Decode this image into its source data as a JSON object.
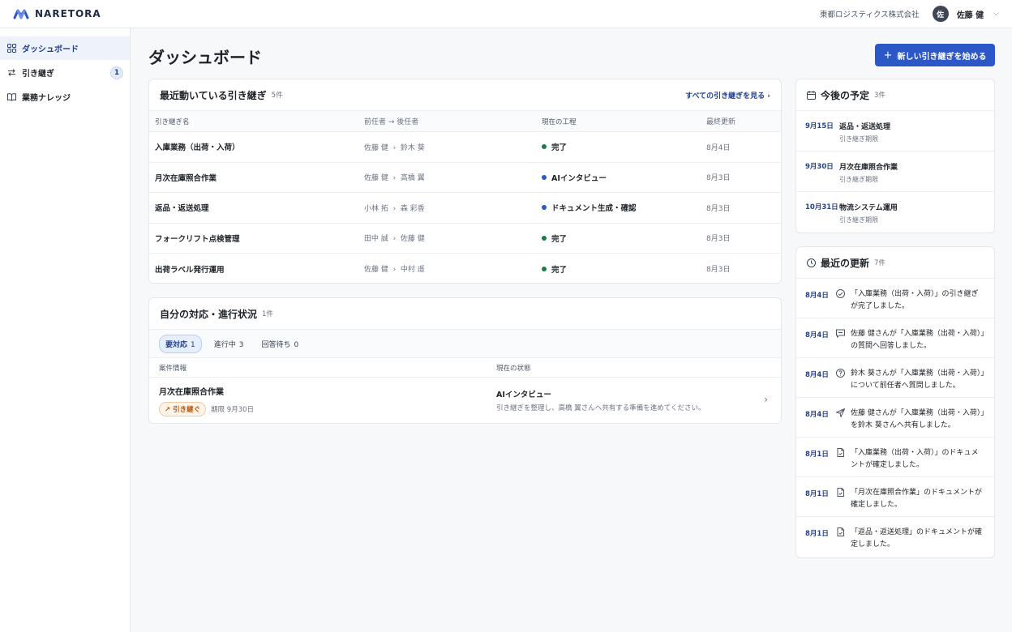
{
  "brand": {
    "name": "NARETORA"
  },
  "user": {
    "company": "東都ロジスティクス株式会社",
    "avatar_initial": "佐",
    "name": "佐藤 健"
  },
  "sidebar": {
    "items": [
      {
        "label": "ダッシュボード",
        "icon": "grid-icon",
        "active": true
      },
      {
        "label": "引き継ぎ",
        "icon": "swap-icon",
        "badge": "1"
      },
      {
        "label": "業務ナレッジ",
        "icon": "book-icon"
      }
    ]
  },
  "page": {
    "title": "ダッシュボード",
    "new_button": "新しい引き継ぎを始める"
  },
  "handovers": {
    "title": "最近動いている引き継ぎ",
    "count": "5件",
    "see_all": "すべての引き継ぎを見る",
    "columns": [
      "引き継ぎ名",
      "前任者 → 後任者",
      "現在の工程",
      "最終更新"
    ],
    "rows": [
      {
        "name": "入庫業務（出荷・入荷）",
        "from": "佐藤 健",
        "to": "鈴木 葵",
        "stage": "完了",
        "stage_color": "#1f7a4a",
        "updated": "8月4日"
      },
      {
        "name": "月次在庫照合作業",
        "from": "佐藤 健",
        "to": "高橋 翼",
        "stage": "AIインタビュー",
        "stage_color": "#2b57c7",
        "updated": "8月3日"
      },
      {
        "name": "返品・返送処理",
        "from": "小林 拓",
        "to": "森 彩香",
        "stage": "ドキュメント生成・確認",
        "stage_color": "#2b57c7",
        "updated": "8月3日"
      },
      {
        "name": "フォークリフト点検管理",
        "from": "田中 誠",
        "to": "佐藤 健",
        "stage": "完了",
        "stage_color": "#1f7a4a",
        "updated": "8月3日"
      },
      {
        "name": "出荷ラベル発行運用",
        "from": "佐藤 健",
        "to": "中村 遥",
        "stage": "完了",
        "stage_color": "#1f7a4a",
        "updated": "8月3日"
      }
    ]
  },
  "tasks": {
    "title": "自分の対応・進行状況",
    "count": "1件",
    "tabs": [
      {
        "label": "要対応",
        "count": "1",
        "active": true
      },
      {
        "label": "進行中",
        "count": "3"
      },
      {
        "label": "回答待ち",
        "count": "0"
      }
    ],
    "columns": [
      "案件情報",
      "現在の状態"
    ],
    "rows": [
      {
        "name": "月次在庫照合作業",
        "tag": "引き継ぐ",
        "due": "期限 9月30日",
        "state": "AIインタビュー",
        "state_desc": "引き継ぎを整理し、高橋 翼さんへ共有する準備を進めてください。"
      }
    ]
  },
  "schedule": {
    "title": "今後の予定",
    "count": "3件",
    "items": [
      {
        "date": "9月15日",
        "title": "返品・返送処理",
        "sub": "引き継ぎ期限"
      },
      {
        "date": "9月30日",
        "title": "月次在庫照合作業",
        "sub": "引き継ぎ期限"
      },
      {
        "date": "10月31日",
        "title": "物流システム運用",
        "sub": "引き継ぎ期限"
      }
    ]
  },
  "updates": {
    "title": "最近の更新",
    "count": "7件",
    "items": [
      {
        "date": "8月4日",
        "icon": "check-circle-icon",
        "text": "「入庫業務（出荷・入荷）」の引き継ぎが完了しました。"
      },
      {
        "date": "8月4日",
        "icon": "message-icon",
        "text": "佐藤 健さんが「入庫業務（出荷・入荷）」の質問へ回答しました。"
      },
      {
        "date": "8月4日",
        "icon": "question-icon",
        "text": "鈴木 葵さんが「入庫業務（出荷・入荷）」について前任者へ質問しました。"
      },
      {
        "date": "8月4日",
        "icon": "send-icon",
        "text": "佐藤 健さんが「入庫業務（出荷・入荷）」を鈴木 葵さんへ共有しました。"
      },
      {
        "date": "8月1日",
        "icon": "document-icon",
        "text": "「入庫業務（出荷・入荷）」のドキュメントが確定しました。"
      },
      {
        "date": "8月1日",
        "icon": "document-icon",
        "text": "「月次在庫照合作業」のドキュメントが確定しました。"
      },
      {
        "date": "8月1日",
        "icon": "document-icon",
        "text": "「返品・返送処理」のドキュメントが確定しました。"
      }
    ]
  }
}
